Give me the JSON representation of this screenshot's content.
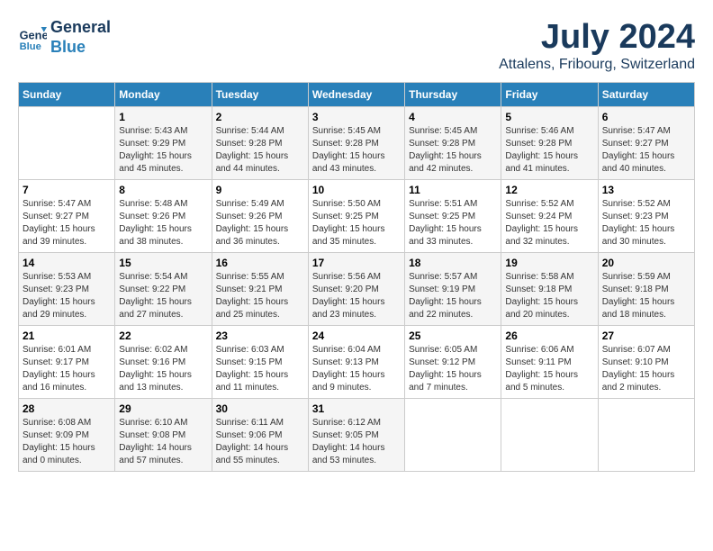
{
  "header": {
    "logo_line1": "General",
    "logo_line2": "Blue",
    "title": "July 2024",
    "subtitle": "Attalens, Fribourg, Switzerland"
  },
  "weekdays": [
    "Sunday",
    "Monday",
    "Tuesday",
    "Wednesday",
    "Thursday",
    "Friday",
    "Saturday"
  ],
  "weeks": [
    [
      {
        "day": "",
        "sunrise": "",
        "sunset": "",
        "daylight": ""
      },
      {
        "day": "1",
        "sunrise": "Sunrise: 5:43 AM",
        "sunset": "Sunset: 9:29 PM",
        "daylight": "Daylight: 15 hours and 45 minutes."
      },
      {
        "day": "2",
        "sunrise": "Sunrise: 5:44 AM",
        "sunset": "Sunset: 9:28 PM",
        "daylight": "Daylight: 15 hours and 44 minutes."
      },
      {
        "day": "3",
        "sunrise": "Sunrise: 5:45 AM",
        "sunset": "Sunset: 9:28 PM",
        "daylight": "Daylight: 15 hours and 43 minutes."
      },
      {
        "day": "4",
        "sunrise": "Sunrise: 5:45 AM",
        "sunset": "Sunset: 9:28 PM",
        "daylight": "Daylight: 15 hours and 42 minutes."
      },
      {
        "day": "5",
        "sunrise": "Sunrise: 5:46 AM",
        "sunset": "Sunset: 9:28 PM",
        "daylight": "Daylight: 15 hours and 41 minutes."
      },
      {
        "day": "6",
        "sunrise": "Sunrise: 5:47 AM",
        "sunset": "Sunset: 9:27 PM",
        "daylight": "Daylight: 15 hours and 40 minutes."
      }
    ],
    [
      {
        "day": "7",
        "sunrise": "Sunrise: 5:47 AM",
        "sunset": "Sunset: 9:27 PM",
        "daylight": "Daylight: 15 hours and 39 minutes."
      },
      {
        "day": "8",
        "sunrise": "Sunrise: 5:48 AM",
        "sunset": "Sunset: 9:26 PM",
        "daylight": "Daylight: 15 hours and 38 minutes."
      },
      {
        "day": "9",
        "sunrise": "Sunrise: 5:49 AM",
        "sunset": "Sunset: 9:26 PM",
        "daylight": "Daylight: 15 hours and 36 minutes."
      },
      {
        "day": "10",
        "sunrise": "Sunrise: 5:50 AM",
        "sunset": "Sunset: 9:25 PM",
        "daylight": "Daylight: 15 hours and 35 minutes."
      },
      {
        "day": "11",
        "sunrise": "Sunrise: 5:51 AM",
        "sunset": "Sunset: 9:25 PM",
        "daylight": "Daylight: 15 hours and 33 minutes."
      },
      {
        "day": "12",
        "sunrise": "Sunrise: 5:52 AM",
        "sunset": "Sunset: 9:24 PM",
        "daylight": "Daylight: 15 hours and 32 minutes."
      },
      {
        "day": "13",
        "sunrise": "Sunrise: 5:52 AM",
        "sunset": "Sunset: 9:23 PM",
        "daylight": "Daylight: 15 hours and 30 minutes."
      }
    ],
    [
      {
        "day": "14",
        "sunrise": "Sunrise: 5:53 AM",
        "sunset": "Sunset: 9:23 PM",
        "daylight": "Daylight: 15 hours and 29 minutes."
      },
      {
        "day": "15",
        "sunrise": "Sunrise: 5:54 AM",
        "sunset": "Sunset: 9:22 PM",
        "daylight": "Daylight: 15 hours and 27 minutes."
      },
      {
        "day": "16",
        "sunrise": "Sunrise: 5:55 AM",
        "sunset": "Sunset: 9:21 PM",
        "daylight": "Daylight: 15 hours and 25 minutes."
      },
      {
        "day": "17",
        "sunrise": "Sunrise: 5:56 AM",
        "sunset": "Sunset: 9:20 PM",
        "daylight": "Daylight: 15 hours and 23 minutes."
      },
      {
        "day": "18",
        "sunrise": "Sunrise: 5:57 AM",
        "sunset": "Sunset: 9:19 PM",
        "daylight": "Daylight: 15 hours and 22 minutes."
      },
      {
        "day": "19",
        "sunrise": "Sunrise: 5:58 AM",
        "sunset": "Sunset: 9:18 PM",
        "daylight": "Daylight: 15 hours and 20 minutes."
      },
      {
        "day": "20",
        "sunrise": "Sunrise: 5:59 AM",
        "sunset": "Sunset: 9:18 PM",
        "daylight": "Daylight: 15 hours and 18 minutes."
      }
    ],
    [
      {
        "day": "21",
        "sunrise": "Sunrise: 6:01 AM",
        "sunset": "Sunset: 9:17 PM",
        "daylight": "Daylight: 15 hours and 16 minutes."
      },
      {
        "day": "22",
        "sunrise": "Sunrise: 6:02 AM",
        "sunset": "Sunset: 9:16 PM",
        "daylight": "Daylight: 15 hours and 13 minutes."
      },
      {
        "day": "23",
        "sunrise": "Sunrise: 6:03 AM",
        "sunset": "Sunset: 9:15 PM",
        "daylight": "Daylight: 15 hours and 11 minutes."
      },
      {
        "day": "24",
        "sunrise": "Sunrise: 6:04 AM",
        "sunset": "Sunset: 9:13 PM",
        "daylight": "Daylight: 15 hours and 9 minutes."
      },
      {
        "day": "25",
        "sunrise": "Sunrise: 6:05 AM",
        "sunset": "Sunset: 9:12 PM",
        "daylight": "Daylight: 15 hours and 7 minutes."
      },
      {
        "day": "26",
        "sunrise": "Sunrise: 6:06 AM",
        "sunset": "Sunset: 9:11 PM",
        "daylight": "Daylight: 15 hours and 5 minutes."
      },
      {
        "day": "27",
        "sunrise": "Sunrise: 6:07 AM",
        "sunset": "Sunset: 9:10 PM",
        "daylight": "Daylight: 15 hours and 2 minutes."
      }
    ],
    [
      {
        "day": "28",
        "sunrise": "Sunrise: 6:08 AM",
        "sunset": "Sunset: 9:09 PM",
        "daylight": "Daylight: 15 hours and 0 minutes."
      },
      {
        "day": "29",
        "sunrise": "Sunrise: 6:10 AM",
        "sunset": "Sunset: 9:08 PM",
        "daylight": "Daylight: 14 hours and 57 minutes."
      },
      {
        "day": "30",
        "sunrise": "Sunrise: 6:11 AM",
        "sunset": "Sunset: 9:06 PM",
        "daylight": "Daylight: 14 hours and 55 minutes."
      },
      {
        "day": "31",
        "sunrise": "Sunrise: 6:12 AM",
        "sunset": "Sunset: 9:05 PM",
        "daylight": "Daylight: 14 hours and 53 minutes."
      },
      {
        "day": "",
        "sunrise": "",
        "sunset": "",
        "daylight": ""
      },
      {
        "day": "",
        "sunrise": "",
        "sunset": "",
        "daylight": ""
      },
      {
        "day": "",
        "sunrise": "",
        "sunset": "",
        "daylight": ""
      }
    ]
  ]
}
